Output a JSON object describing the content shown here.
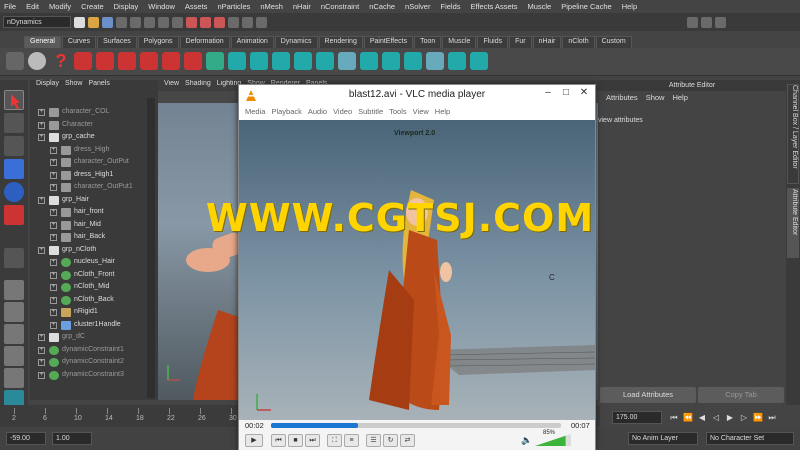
{
  "menubar": [
    "File",
    "Edit",
    "Modify",
    "Create",
    "Display",
    "Window",
    "Assets",
    "nParticles",
    "nMesh",
    "nHair",
    "nConstraint",
    "nCache",
    "nSolver",
    "Fields",
    "Effects Assets",
    "Muscle",
    "Pipeline Cache",
    "Help"
  ],
  "menu_set": "nDynamics",
  "shelf_tabs": [
    {
      "label": "General",
      "active": true
    },
    {
      "label": "Curves"
    },
    {
      "label": "Surfaces"
    },
    {
      "label": "Polygons"
    },
    {
      "label": "Deformation"
    },
    {
      "label": "Animation"
    },
    {
      "label": "Dynamics"
    },
    {
      "label": "Rendering"
    },
    {
      "label": "PaintEffects"
    },
    {
      "label": "Toon"
    },
    {
      "label": "Muscle"
    },
    {
      "label": "Fluids"
    },
    {
      "label": "Fur"
    },
    {
      "label": "nHair"
    },
    {
      "label": "nCloth"
    },
    {
      "label": "Custom"
    }
  ],
  "outliner": {
    "menu": [
      "Display",
      "Show",
      "Panels"
    ],
    "items": [
      {
        "label": "character_COL",
        "indent": 1,
        "style": "dim"
      },
      {
        "label": "Character",
        "indent": 1,
        "style": "dim"
      },
      {
        "label": "grp_cache",
        "indent": 1,
        "style": "normal"
      },
      {
        "label": "dress_High",
        "indent": 2,
        "style": "dim"
      },
      {
        "label": "character_OutPut",
        "indent": 2,
        "style": "dim"
      },
      {
        "label": "dress_High1",
        "indent": 2,
        "style": "normal"
      },
      {
        "label": "character_OutPut1",
        "indent": 2,
        "style": "dim"
      },
      {
        "label": "grp_Hair",
        "indent": 1,
        "style": "normal"
      },
      {
        "label": "hair_front",
        "indent": 2,
        "style": "normal"
      },
      {
        "label": "hair_Mid",
        "indent": 2,
        "style": "normal"
      },
      {
        "label": "hair_Back",
        "indent": 2,
        "style": "normal"
      },
      {
        "label": "grp_nCloth",
        "indent": 1,
        "style": "normal"
      },
      {
        "label": "nucleus_Hair",
        "indent": 2,
        "style": "normal"
      },
      {
        "label": "nCloth_Front",
        "indent": 2,
        "style": "normal"
      },
      {
        "label": "nCloth_Mid",
        "indent": 2,
        "style": "normal"
      },
      {
        "label": "nCloth_Back",
        "indent": 2,
        "style": "normal"
      },
      {
        "label": "nRigid1",
        "indent": 2,
        "style": "normal"
      },
      {
        "label": "cluster1Handle",
        "indent": 2,
        "style": "normal"
      },
      {
        "label": "grp_dC",
        "indent": 1,
        "style": "dim"
      },
      {
        "label": "dynamicConstraint1",
        "indent": 1,
        "style": "dim"
      },
      {
        "label": "dynamicConstraint2",
        "indent": 1,
        "style": "dim"
      },
      {
        "label": "dynamicConstraint3",
        "indent": 1,
        "style": "dim"
      }
    ]
  },
  "viewport": {
    "menu": [
      "View",
      "Shading",
      "Lighting",
      "Show",
      "Renderer",
      "Panels"
    ]
  },
  "attribute_editor": {
    "title": "Attribute Editor",
    "menu": [
      "Attributes",
      "Show",
      "Help"
    ],
    "message": "view attributes",
    "load_button": "Load Attributes",
    "copy_tab_button": "Copy Tab"
  },
  "side_tabs": [
    "Channel Box / Layer Editor",
    "Attribute Editor"
  ],
  "timeline": {
    "ticks": [
      "2",
      "6",
      "10",
      "14",
      "18",
      "22",
      "26",
      "30",
      "34",
      "38",
      "42",
      "46",
      "50",
      "54",
      "58",
      "62",
      "66",
      "70",
      "74"
    ]
  },
  "range": {
    "current_start": "-59.00",
    "start": "1.00",
    "end_frame": "175.00",
    "anim_layer": "No Anim Layer",
    "character_set": "No Character Set"
  },
  "vlc": {
    "title": "blast12.avi - VLC media player",
    "menu": [
      "Media",
      "Playback",
      "Audio",
      "Video",
      "Subtitle",
      "Tools",
      "View",
      "Help"
    ],
    "viewport_label": "Viewport 2.0",
    "time_elapsed": "00:02",
    "time_total": "00:07",
    "progress": 0.3,
    "volume": "85%",
    "volume_level": 0.85
  },
  "watermark": "WWW.CGTSJ.COM",
  "colors": {
    "watermark": "#ffd400",
    "maya_bg": "#444444",
    "vlc_accent": "#1a76d2"
  }
}
